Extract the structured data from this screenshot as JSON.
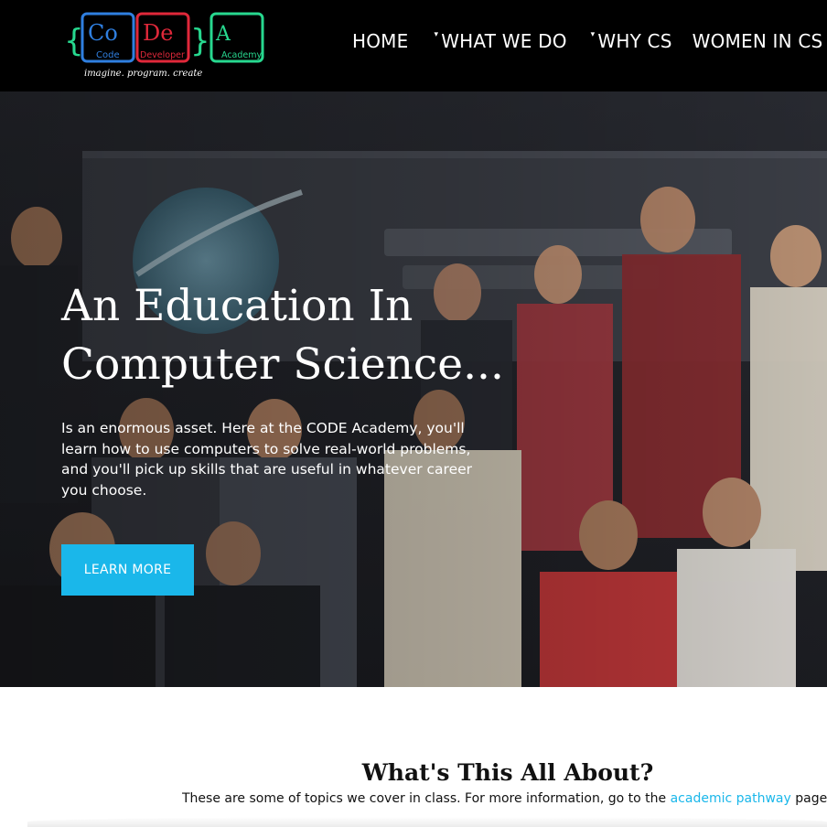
{
  "logo": {
    "left_brace": "{",
    "right_brace": "}",
    "tile1_symbol": "Co",
    "tile1_name": "Code",
    "tile2_symbol": "De",
    "tile2_name": "Developer",
    "tile3_symbol": "A",
    "tile3_name": "Academy",
    "tagline": "imagine. program. create"
  },
  "nav": {
    "home": "HOME",
    "what_we_do": "WHAT WE DO",
    "why_cs": "WHY CS",
    "women_in_cs": "WOMEN IN CS",
    "caret": "▾"
  },
  "hero": {
    "title": "An Education In Computer Science...",
    "text": "Is an enormous asset. Here at the CODE Academy, you'll learn how to use computers to solve real-world problems, and you'll pick up skills that are useful in whatever career you choose.",
    "button": "LEARN MORE"
  },
  "about": {
    "title": "What's This All About?",
    "text_before": "These are some of topics we cover in class. For more information, go to the",
    "link": "academic pathway",
    "text_after": "page."
  },
  "colors": {
    "header_bg": "#000000",
    "accent": "#1ab7ea",
    "logo_blue": "#2f7fe0",
    "logo_red": "#e0283a",
    "logo_green": "#27d88f"
  }
}
